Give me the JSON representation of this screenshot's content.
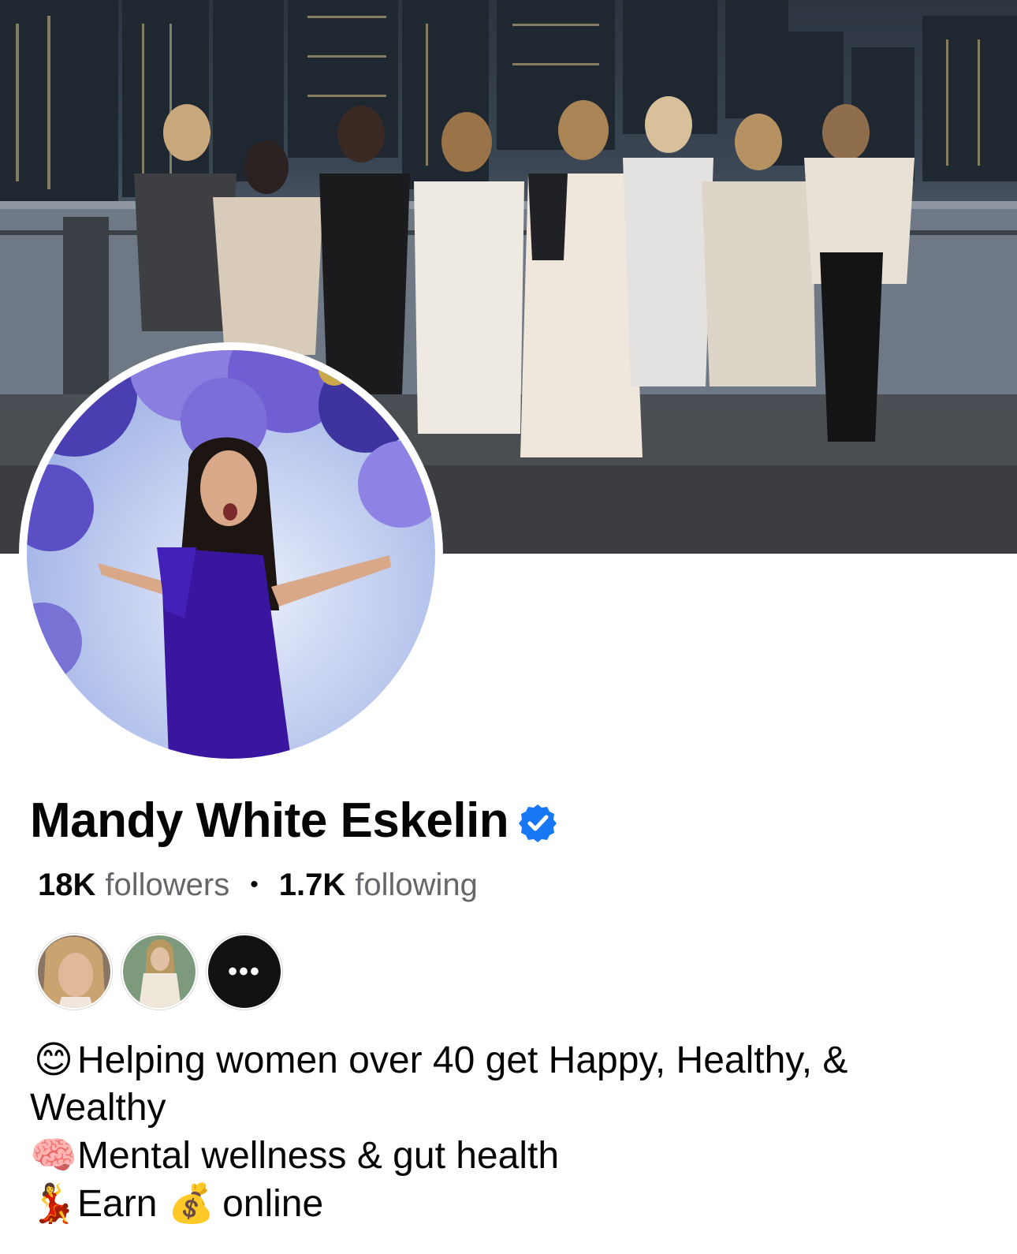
{
  "profile": {
    "name": "Mandy White Eskelin",
    "verified": true,
    "accent_color": "#1877f2"
  },
  "stats": {
    "followers_count": "18K",
    "followers_label": "followers",
    "separator": "•",
    "following_count": "1.7K",
    "following_label": "following"
  },
  "mutuals": {
    "more_label": "•••"
  },
  "bio": {
    "line1_emoji": "😊",
    "line1_text": "Helping women over 40 get Happy, Healthy, &",
    "line1_cont": "Wealthy",
    "line2_emoji": "🧠",
    "line2_text": "Mental wellness & gut health",
    "line3_emoji": "💃",
    "line3_text_a": "Earn",
    "line3_emoji_b": "💰",
    "line3_text_b": "online"
  }
}
